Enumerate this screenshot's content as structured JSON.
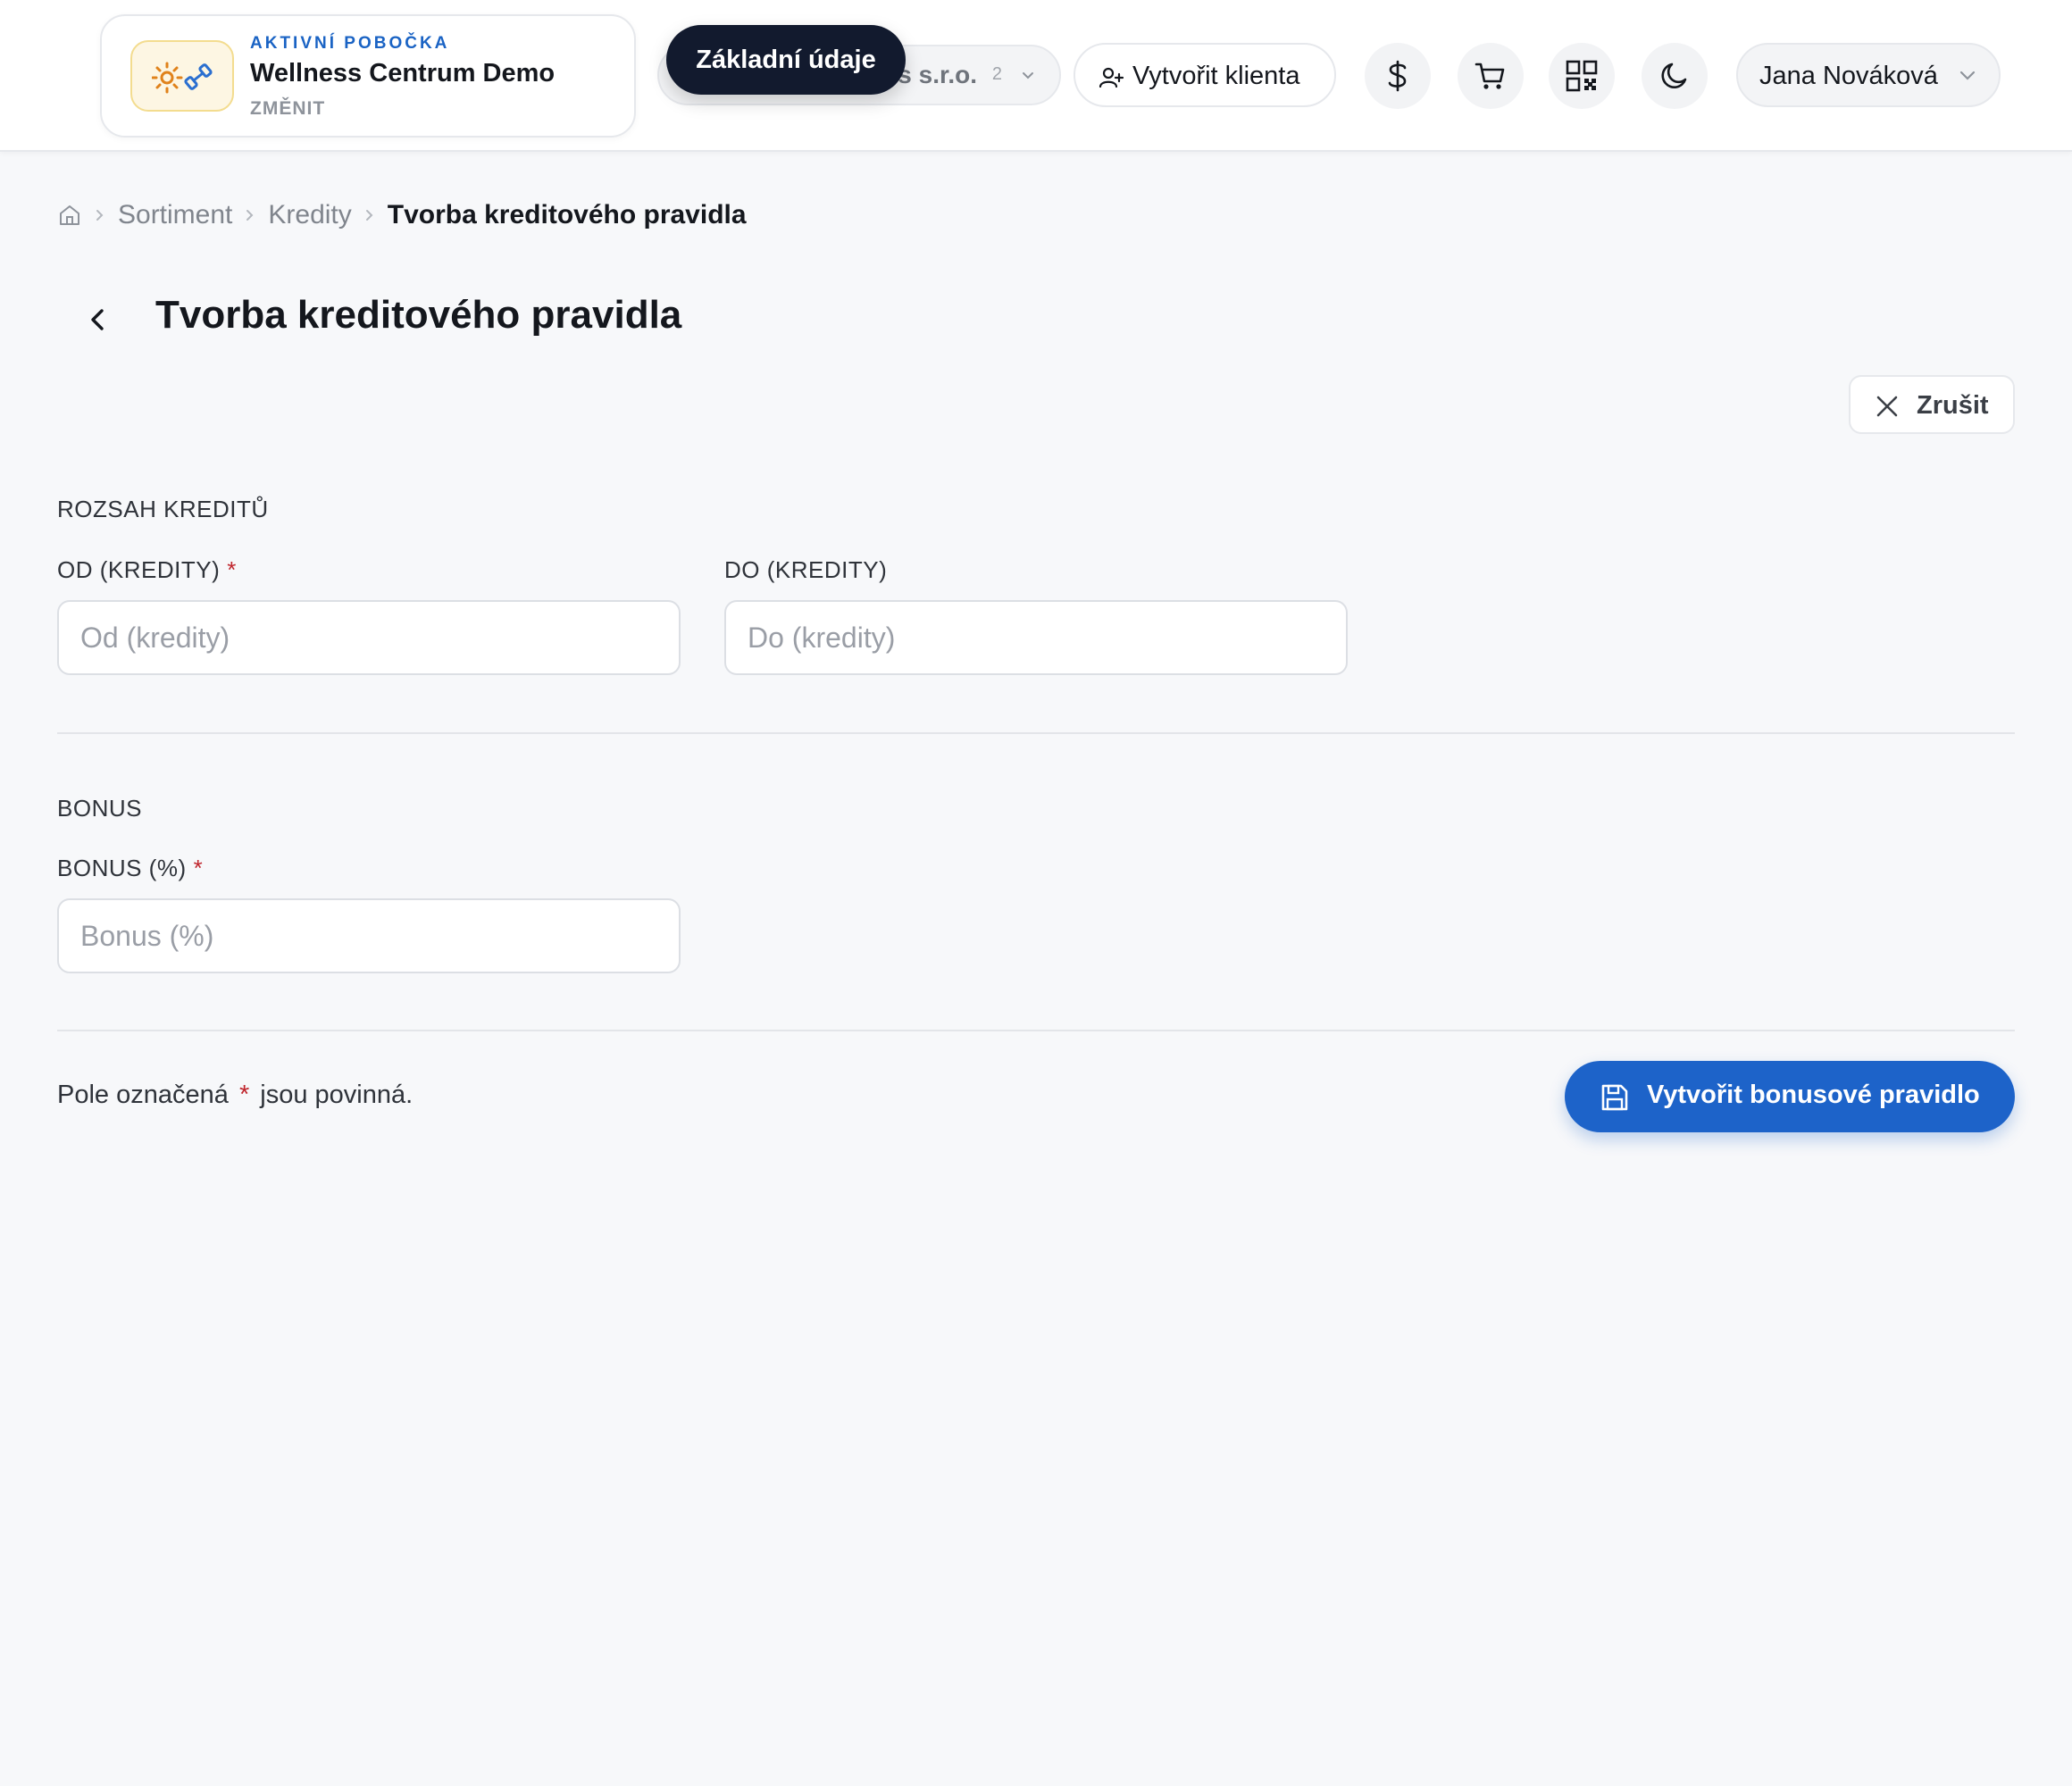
{
  "header": {
    "branch": {
      "kicker": "AKTIVNÍ POBOČKA",
      "name": "Wellness Centrum Demo",
      "change_label": "ZMĚNIT"
    },
    "company_select": {
      "label": "s s.r.o.",
      "count": "2"
    },
    "tooltip": "Základní údaje",
    "create_client_label": "Vytvořit klienta",
    "icons": [
      "dollar-icon",
      "cart-icon",
      "qr-code-icon",
      "moon-icon"
    ],
    "user_name": "Jana Nováková"
  },
  "breadcrumb": {
    "items": [
      "Sortiment",
      "Kredity",
      "Tvorba kreditového pravidla"
    ]
  },
  "page": {
    "title": "Tvorba kreditového pravidla",
    "cancel_label": "Zrušit"
  },
  "form": {
    "range_section_title": "ROZSAH KREDITŮ",
    "from_label": "OD (KREDITY)",
    "from_placeholder": "Od (kredity)",
    "from_value": "",
    "to_label": "DO (KREDITY)",
    "to_placeholder": "Do (kredity)",
    "to_value": "",
    "bonus_section_title": "BONUS",
    "bonus_label": "BONUS (%)",
    "bonus_placeholder": "Bonus (%)",
    "bonus_value": "",
    "required_marker": "*",
    "footnote_before": "Pole označená",
    "footnote_after": "jsou povinná.",
    "submit_label": "Vytvořit bonusové pravidlo"
  },
  "colors": {
    "accent": "#1d63c9",
    "tooltip_bg": "#121a2e",
    "required": "#c0262d",
    "background": "#f7f8fa"
  }
}
